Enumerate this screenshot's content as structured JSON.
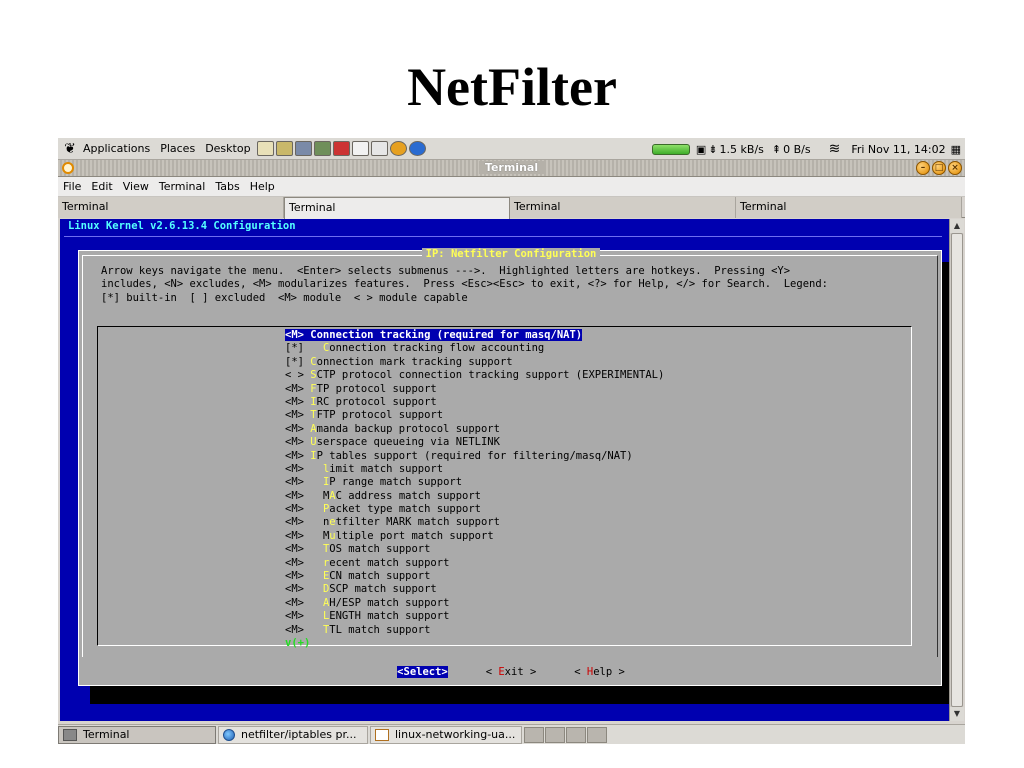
{
  "slide_title": "NetFilter",
  "top_panel": {
    "menus": [
      "Applications",
      "Places",
      "Desktop"
    ],
    "net_down": "1.5 kB/s",
    "net_up": "0 B/s",
    "clock": "Fri Nov 11, 14:02"
  },
  "window": {
    "title": "Terminal",
    "menus": [
      "File",
      "Edit",
      "View",
      "Terminal",
      "Tabs",
      "Help"
    ],
    "tabs": [
      "Terminal",
      "Terminal",
      "Terminal",
      "Terminal"
    ],
    "active_tab": 1
  },
  "menuconfig": {
    "header": "Linux Kernel v2.6.13.4 Configuration",
    "dialog_title": "IP: Netfilter Configuration",
    "help_lines": [
      "Arrow keys navigate the menu.  <Enter> selects submenus --->.  Highlighted letters are hotkeys.  Pressing <Y>",
      "includes, <N> excludes, <M> modularizes features.  Press <Esc><Esc> to exit, <?> for Help, </> for Search.  Legend:",
      "[*] built-in  [ ] excluded  <M> module  < > module capable"
    ],
    "items": [
      {
        "marker": "<M>",
        "marker_start": "<",
        "marker_hl": "M",
        "marker_rest": ">",
        "hotkey_char": "C",
        "rest": "onnection tracking (required for masq/NAT)",
        "text": "<M> Connection tracking (required for masq/NAT)",
        "selected": true
      },
      {
        "marker": "[*]",
        "indent": "  ",
        "hotkey": "C",
        "rest": "onnection tracking flow accounting"
      },
      {
        "marker": "[*]",
        "indent": "",
        "hotkey": "C",
        "rest": "onnection mark tracking support"
      },
      {
        "marker": "< >",
        "indent": "",
        "hotkey": "S",
        "rest": "CTP protocol connection tracking support (EXPERIMENTAL)"
      },
      {
        "marker": "<M>",
        "indent": "",
        "hotkey": "F",
        "rest": "TP protocol support"
      },
      {
        "marker": "<M>",
        "indent": "",
        "hotkey": "I",
        "rest": "RC protocol support"
      },
      {
        "marker": "<M>",
        "indent": "",
        "hotkey": "T",
        "rest": "FTP protocol support"
      },
      {
        "marker": "<M>",
        "indent": "",
        "hotkey": "A",
        "rest": "manda backup protocol support"
      },
      {
        "marker": "<M>",
        "indent": "",
        "hotkey": "U",
        "rest": "serspace queueing via NETLINK"
      },
      {
        "marker": "<M>",
        "indent": "",
        "hotkey": "I",
        "rest": "P tables support (required for filtering/masq/NAT)"
      },
      {
        "marker": "<M>",
        "indent": "  ",
        "hotkey": "l",
        "rest": "imit match support"
      },
      {
        "marker": "<M>",
        "indent": "  ",
        "hotkey": "I",
        "rest": "P range match support"
      },
      {
        "marker": "<M>",
        "indent": "  ",
        "pre": "M",
        "hotkey": "A",
        "rest": "C address match support"
      },
      {
        "marker": "<M>",
        "indent": "  ",
        "hotkey": "P",
        "rest": "acket type match support"
      },
      {
        "marker": "<M>",
        "indent": "  ",
        "pre": "n",
        "hotkey": "e",
        "rest": "tfilter MARK match support"
      },
      {
        "marker": "<M>",
        "indent": "  ",
        "pre": "M",
        "hotkey": "u",
        "rest": "ltiple port match support"
      },
      {
        "marker": "<M>",
        "indent": "  ",
        "hotkey": "T",
        "rest": "OS match support"
      },
      {
        "marker": "<M>",
        "indent": "  ",
        "hotkey": "r",
        "rest": "ecent match support"
      },
      {
        "marker": "<M>",
        "indent": "  ",
        "hotkey": "E",
        "rest": "CN match support"
      },
      {
        "marker": "<M>",
        "indent": "  ",
        "hotkey": "D",
        "rest": "SCP match support"
      },
      {
        "marker": "<M>",
        "indent": "  ",
        "hotkey": "A",
        "rest": "H/ESP match support"
      },
      {
        "marker": "<M>",
        "indent": "  ",
        "hotkey": "L",
        "rest": "ENGTH match support"
      },
      {
        "marker": "<M>",
        "indent": "  ",
        "hotkey": "T",
        "rest": "TL match support"
      }
    ],
    "more_indicator": "v(+)",
    "buttons": {
      "select": "<Select>",
      "exit_pre": "< ",
      "exit_hk": "E",
      "exit_rest": "xit >",
      "help_pre": "< ",
      "help_hk": "H",
      "help_rest": "elp >"
    }
  },
  "taskbar": {
    "tasks": [
      "Terminal",
      "netfilter/iptables pr...",
      "linux-networking-ua..."
    ]
  },
  "colors": {
    "terminal_bg": "#0000b0",
    "dialog_bg": "#aaaaaa",
    "hotkey": "#ffff55",
    "header_text": "#55ffff"
  }
}
